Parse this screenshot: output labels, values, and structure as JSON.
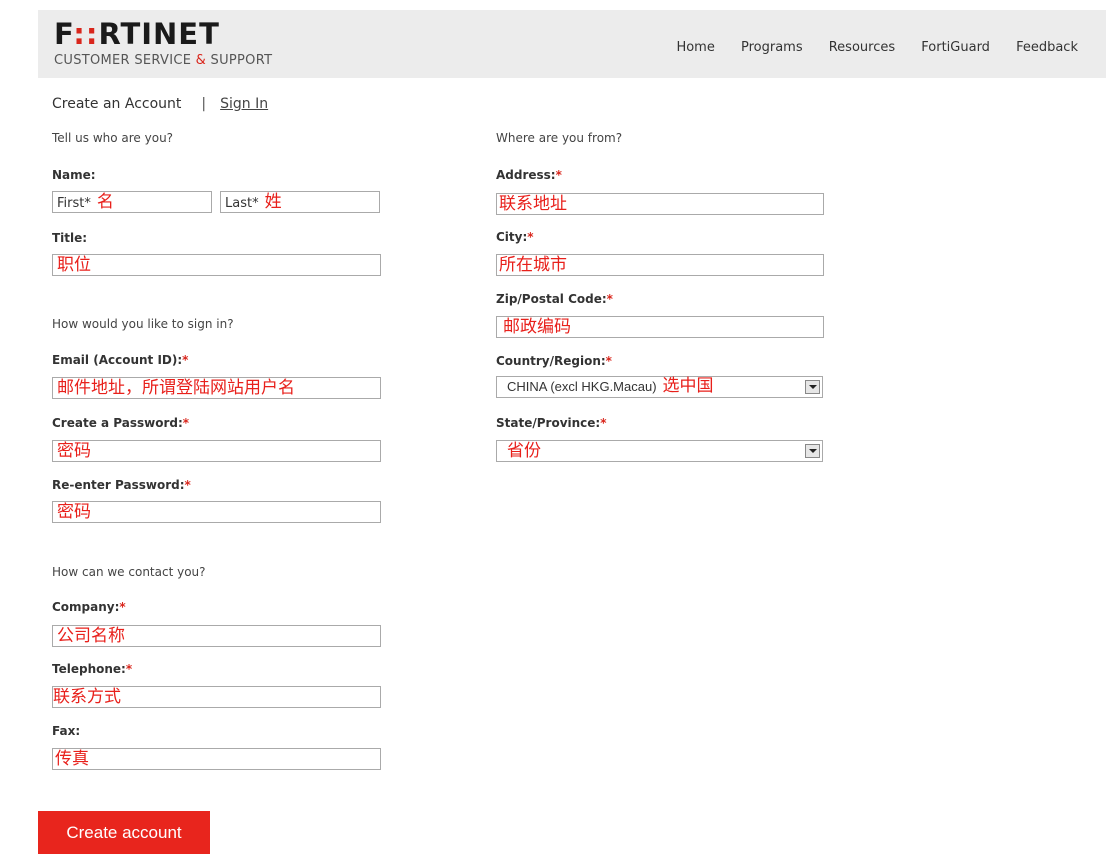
{
  "header": {
    "logo_a": "F",
    "logo_b": "::",
    "logo_c": "RTINET",
    "tagline_a": "CUSTOMER SERVICE ",
    "tagline_amp": "&",
    "tagline_b": " SUPPORT",
    "nav": [
      "Home",
      "Programs",
      "Resources",
      "FortiGuard",
      "Feedback"
    ]
  },
  "tabs": {
    "create": "Create an Account",
    "sep": "|",
    "signin": "Sign In"
  },
  "left": {
    "who_heading": "Tell us who are you?",
    "name_label": "Name:",
    "first_placeholder": "First*",
    "first_value": "名",
    "last_placeholder": "Last*",
    "last_value": "姓",
    "title_label": "Title:",
    "title_value": "职位",
    "signin_heading": "How would you like to sign in?",
    "email_label": "Email (Account ID):",
    "email_value": "邮件地址，所谓登陆网站用户名",
    "password_label": "Create a Password:",
    "password_value": "密码",
    "reenter_label": "Re-enter Password:",
    "reenter_value": "密码",
    "contact_heading": "How can we contact you?",
    "company_label": "Company:",
    "company_value": "公司名称",
    "telephone_label": "Telephone:",
    "telephone_value": "联系方式",
    "fax_label": "Fax:",
    "fax_value": "传真"
  },
  "right": {
    "where_heading": "Where are you from?",
    "address_label": "Address:",
    "address_value": "联系地址",
    "city_label": "City:",
    "city_value": "所在城市",
    "zip_label": "Zip/Postal Code:",
    "zip_value": "邮政编码",
    "country_label": "Country/Region:",
    "country_selected": "CHINA (excl HKG.Macau)",
    "country_note": "选中国",
    "state_label": "State/Province:",
    "state_value": "省份"
  },
  "required_mark": "*",
  "submit_label": "Create account",
  "colors": {
    "accent": "#e8251d",
    "annotation": "#e8201b",
    "header_bg": "#ececec"
  }
}
